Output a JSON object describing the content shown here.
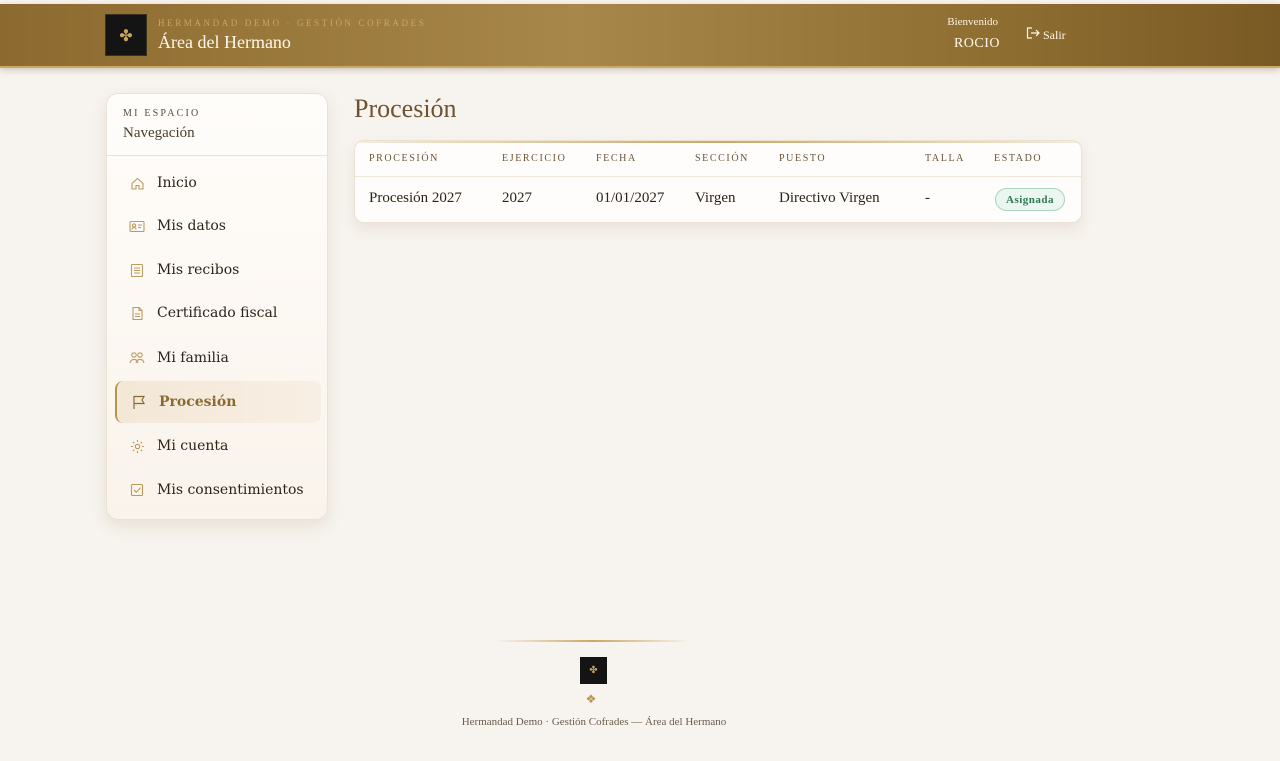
{
  "header": {
    "logo_glyph": "✤",
    "subtitle": "HERMANDAD DEMO · GESTIÓN COFRADES",
    "title": "Área del Hermano",
    "welcome": "Bienvenido",
    "username": "ROCIO",
    "logout_label": "Salir",
    "logout_icon": "logout-icon"
  },
  "sidebar": {
    "kicker": "MI ESPACIO",
    "title": "Navegación",
    "items": [
      {
        "label": "Inicio",
        "icon": "home-icon"
      },
      {
        "label": "Mis datos",
        "icon": "id-card-icon"
      },
      {
        "label": "Mis recibos",
        "icon": "receipt-icon"
      },
      {
        "label": "Certificado fiscal",
        "icon": "document-icon"
      },
      {
        "label": "Mi familia",
        "icon": "users-icon"
      },
      {
        "label": "Procesión",
        "icon": "flag-icon",
        "active": true
      },
      {
        "label": "Mi cuenta",
        "icon": "gear-icon"
      },
      {
        "label": "Mis consentimientos",
        "icon": "checkbox-icon"
      }
    ]
  },
  "main": {
    "title": "Procesión",
    "table": {
      "columns": [
        "PROCESIÓN",
        "EJERCICIO",
        "FECHA",
        "SECCIÓN",
        "PUESTO",
        "TALLA",
        "ESTADO"
      ],
      "rows": [
        {
          "procesion": "Procesión 2027",
          "ejercicio": "2027",
          "fecha": "01/01/2027",
          "seccion": "Virgen",
          "puesto": "Directivo Virgen",
          "talla": "-",
          "estado": "Asignada"
        }
      ]
    }
  },
  "footer": {
    "ornament": "❖",
    "text": "Hermandad Demo · Gestión Cofrades — Área del Hermano"
  },
  "colors": {
    "brand_gold": "#a8874a",
    "accent": "#8a6a33",
    "status_green": "#2e7a55",
    "background": "#f7f3ee"
  }
}
